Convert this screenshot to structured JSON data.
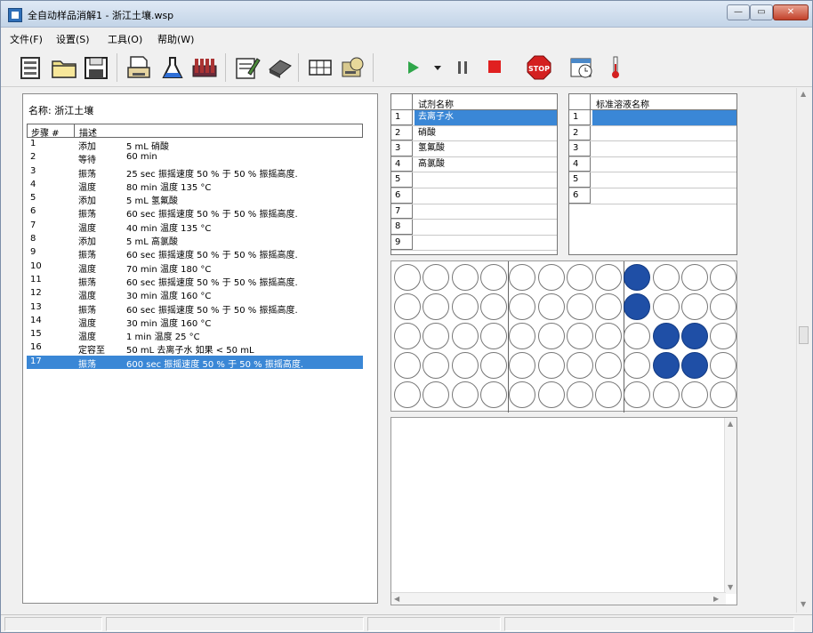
{
  "window": {
    "title": "全自动样品消解1 - 浙江土壤.wsp",
    "minimize_label": "—",
    "maximize_label": "▭",
    "close_label": "✕"
  },
  "menu": [
    "文件(F)",
    "设置(S)",
    "工具(O)",
    "帮助(W)"
  ],
  "toolbar": {
    "icons": [
      "new-file-icon",
      "open-folder-icon",
      "save-icon",
      "print-icon",
      "flask-icon",
      "tube-rack-icon",
      "edit-notebook-icon",
      "eraser-icon",
      "grid-table-icon",
      "machine-icon",
      "play-icon",
      "dropdown-arrow-icon",
      "pause-icon",
      "stop-square-icon",
      "stop-sign-icon",
      "calendar-clock-icon",
      "thermometer-icon"
    ],
    "stop_sign_text": "STOP"
  },
  "method": {
    "name_label": "名称: 浙江土壤",
    "columns": [
      "步骤 #",
      "描述"
    ],
    "steps": [
      {
        "num": "1",
        "type": "添加",
        "desc": "5 mL 硝酸"
      },
      {
        "num": "2",
        "type": "等待",
        "desc": "60 min"
      },
      {
        "num": "3",
        "type": "振荡",
        "desc": "25 sec 振摇速度 50 % 于 50 % 振摇高度."
      },
      {
        "num": "4",
        "type": "温度",
        "desc": "80 min 温度 135 °C"
      },
      {
        "num": "5",
        "type": "添加",
        "desc": "5 mL 氢氟酸"
      },
      {
        "num": "6",
        "type": "振荡",
        "desc": "60 sec 振摇速度 50 % 于 50 % 振摇高度."
      },
      {
        "num": "7",
        "type": "温度",
        "desc": "40 min 温度 135 °C"
      },
      {
        "num": "8",
        "type": "添加",
        "desc": "5 mL 高氯酸"
      },
      {
        "num": "9",
        "type": "振荡",
        "desc": "60 sec 振摇速度 50 % 于 50 % 振摇高度."
      },
      {
        "num": "10",
        "type": "温度",
        "desc": "70 min 温度 180 °C"
      },
      {
        "num": "11",
        "type": "振荡",
        "desc": "60 sec 振摇速度 50 % 于 50 % 振摇高度."
      },
      {
        "num": "12",
        "type": "温度",
        "desc": "30 min 温度 160 °C"
      },
      {
        "num": "13",
        "type": "振荡",
        "desc": "60 sec 振摇速度 50 % 于 50 % 振摇高度."
      },
      {
        "num": "14",
        "type": "温度",
        "desc": "30 min 温度 160 °C"
      },
      {
        "num": "15",
        "type": "温度",
        "desc": "1 min 温度 25 °C"
      },
      {
        "num": "16",
        "type": "定容至",
        "desc": "50 mL 去离子水 如果 < 50 mL"
      },
      {
        "num": "17",
        "type": "振荡",
        "desc": "600 sec 振摇速度 50 % 于 50 % 振摇高度."
      }
    ],
    "selected_step": 17
  },
  "reagents": {
    "title": "试剂名称",
    "rows": [
      {
        "num": "1",
        "name": "去离子水"
      },
      {
        "num": "2",
        "name": "硝酸"
      },
      {
        "num": "3",
        "name": "氢氟酸"
      },
      {
        "num": "4",
        "name": "高氯酸"
      },
      {
        "num": "5",
        "name": ""
      },
      {
        "num": "6",
        "name": ""
      },
      {
        "num": "7",
        "name": ""
      },
      {
        "num": "8",
        "name": ""
      },
      {
        "num": "9",
        "name": ""
      }
    ],
    "selected_row": 1
  },
  "standards": {
    "title": "标准溶液名称",
    "rows": [
      {
        "num": "1",
        "name": ""
      },
      {
        "num": "2",
        "name": ""
      },
      {
        "num": "3",
        "name": ""
      },
      {
        "num": "4",
        "name": ""
      },
      {
        "num": "5",
        "name": ""
      },
      {
        "num": "6",
        "name": ""
      }
    ],
    "selected_row": 1
  },
  "plate": {
    "rows": 5,
    "cols": 12,
    "filled_wells": [
      [
        0,
        8
      ],
      [
        1,
        8
      ],
      [
        2,
        9
      ],
      [
        2,
        10
      ],
      [
        3,
        9
      ],
      [
        3,
        10
      ]
    ],
    "fill_color": "#1f4fa6"
  },
  "status": [
    "",
    "",
    "",
    ""
  ]
}
